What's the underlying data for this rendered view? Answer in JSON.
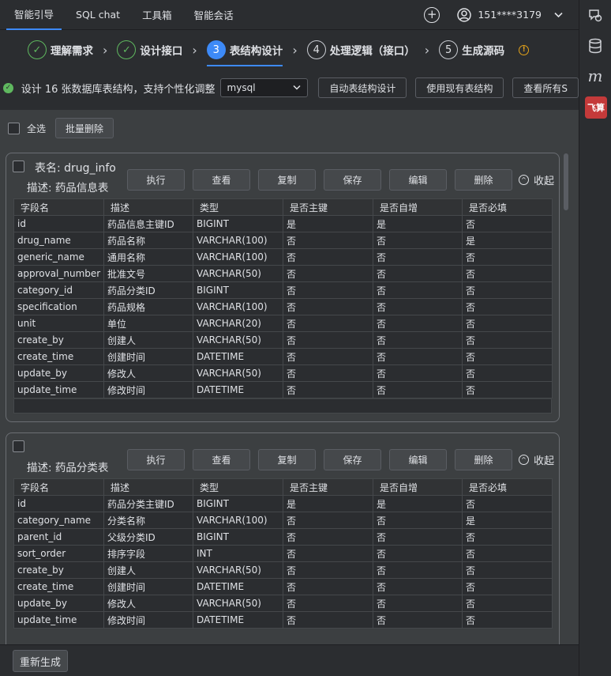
{
  "nav": {
    "tabs": [
      "智能引导",
      "SQL chat",
      "工具箱",
      "智能会话"
    ],
    "active_tab": 0,
    "user_phone": "151****3179"
  },
  "steps": [
    {
      "num": "✓",
      "label": "理解需求",
      "state": "done"
    },
    {
      "num": "✓",
      "label": "设计接口",
      "state": "done"
    },
    {
      "num": "3",
      "label": "表结构设计",
      "state": "active"
    },
    {
      "num": "4",
      "label": "处理逻辑（接口）",
      "state": "todo"
    },
    {
      "num": "5",
      "label": "生成源码",
      "state": "todo"
    }
  ],
  "toolbar": {
    "message": "设计 16 张数据库表结构，支持个性化调整",
    "db_select": "mysql",
    "buttons": [
      "自动表结构设计",
      "使用现有表结构",
      "查看所有S"
    ]
  },
  "selection": {
    "select_all": "全选",
    "batch_delete": "批量删除"
  },
  "card_actions": [
    "执行",
    "查看",
    "复制",
    "保存",
    "编辑",
    "删除"
  ],
  "collapse_label": "收起",
  "columns": [
    "字段名",
    "描述",
    "类型",
    "是否主键",
    "是否自增",
    "是否必填"
  ],
  "tables": [
    {
      "name": "表名: drug_info",
      "desc": "描述: 药品信息表",
      "rows": [
        [
          "id",
          "药品信息主键ID",
          "BIGINT",
          "是",
          "是",
          "否"
        ],
        [
          "drug_name",
          "药品名称",
          "VARCHAR(100)",
          "否",
          "否",
          "是"
        ],
        [
          "generic_name",
          "通用名称",
          "VARCHAR(100)",
          "否",
          "否",
          "否"
        ],
        [
          "approval_number",
          "批准文号",
          "VARCHAR(50)",
          "否",
          "否",
          "否"
        ],
        [
          "category_id",
          "药品分类ID",
          "BIGINT",
          "否",
          "否",
          "否"
        ],
        [
          "specification",
          "药品规格",
          "VARCHAR(100)",
          "否",
          "否",
          "否"
        ],
        [
          "unit",
          "单位",
          "VARCHAR(20)",
          "否",
          "否",
          "否"
        ],
        [
          "create_by",
          "创建人",
          "VARCHAR(50)",
          "否",
          "否",
          "否"
        ],
        [
          "create_time",
          "创建时间",
          "DATETIME",
          "否",
          "否",
          "否"
        ],
        [
          "update_by",
          "修改人",
          "VARCHAR(50)",
          "否",
          "否",
          "否"
        ],
        [
          "update_time",
          "修改时间",
          "DATETIME",
          "否",
          "否",
          "否"
        ]
      ]
    },
    {
      "name": "",
      "desc": "描述: 药品分类表",
      "rows": [
        [
          "id",
          "药品分类主键ID",
          "BIGINT",
          "是",
          "是",
          "否"
        ],
        [
          "category_name",
          "分类名称",
          "VARCHAR(100)",
          "否",
          "否",
          "是"
        ],
        [
          "parent_id",
          "父级分类ID",
          "BIGINT",
          "否",
          "否",
          "否"
        ],
        [
          "sort_order",
          "排序字段",
          "INT",
          "否",
          "否",
          "否"
        ],
        [
          "create_by",
          "创建人",
          "VARCHAR(50)",
          "否",
          "否",
          "否"
        ],
        [
          "create_time",
          "创建时间",
          "DATETIME",
          "否",
          "否",
          "否"
        ],
        [
          "update_by",
          "修改人",
          "VARCHAR(50)",
          "否",
          "否",
          "否"
        ],
        [
          "update_time",
          "修改时间",
          "DATETIME",
          "否",
          "否",
          "否"
        ]
      ]
    }
  ],
  "bottom": {
    "regenerate": "重新生成"
  },
  "sidebar": {
    "feishu_label": "飞算"
  }
}
